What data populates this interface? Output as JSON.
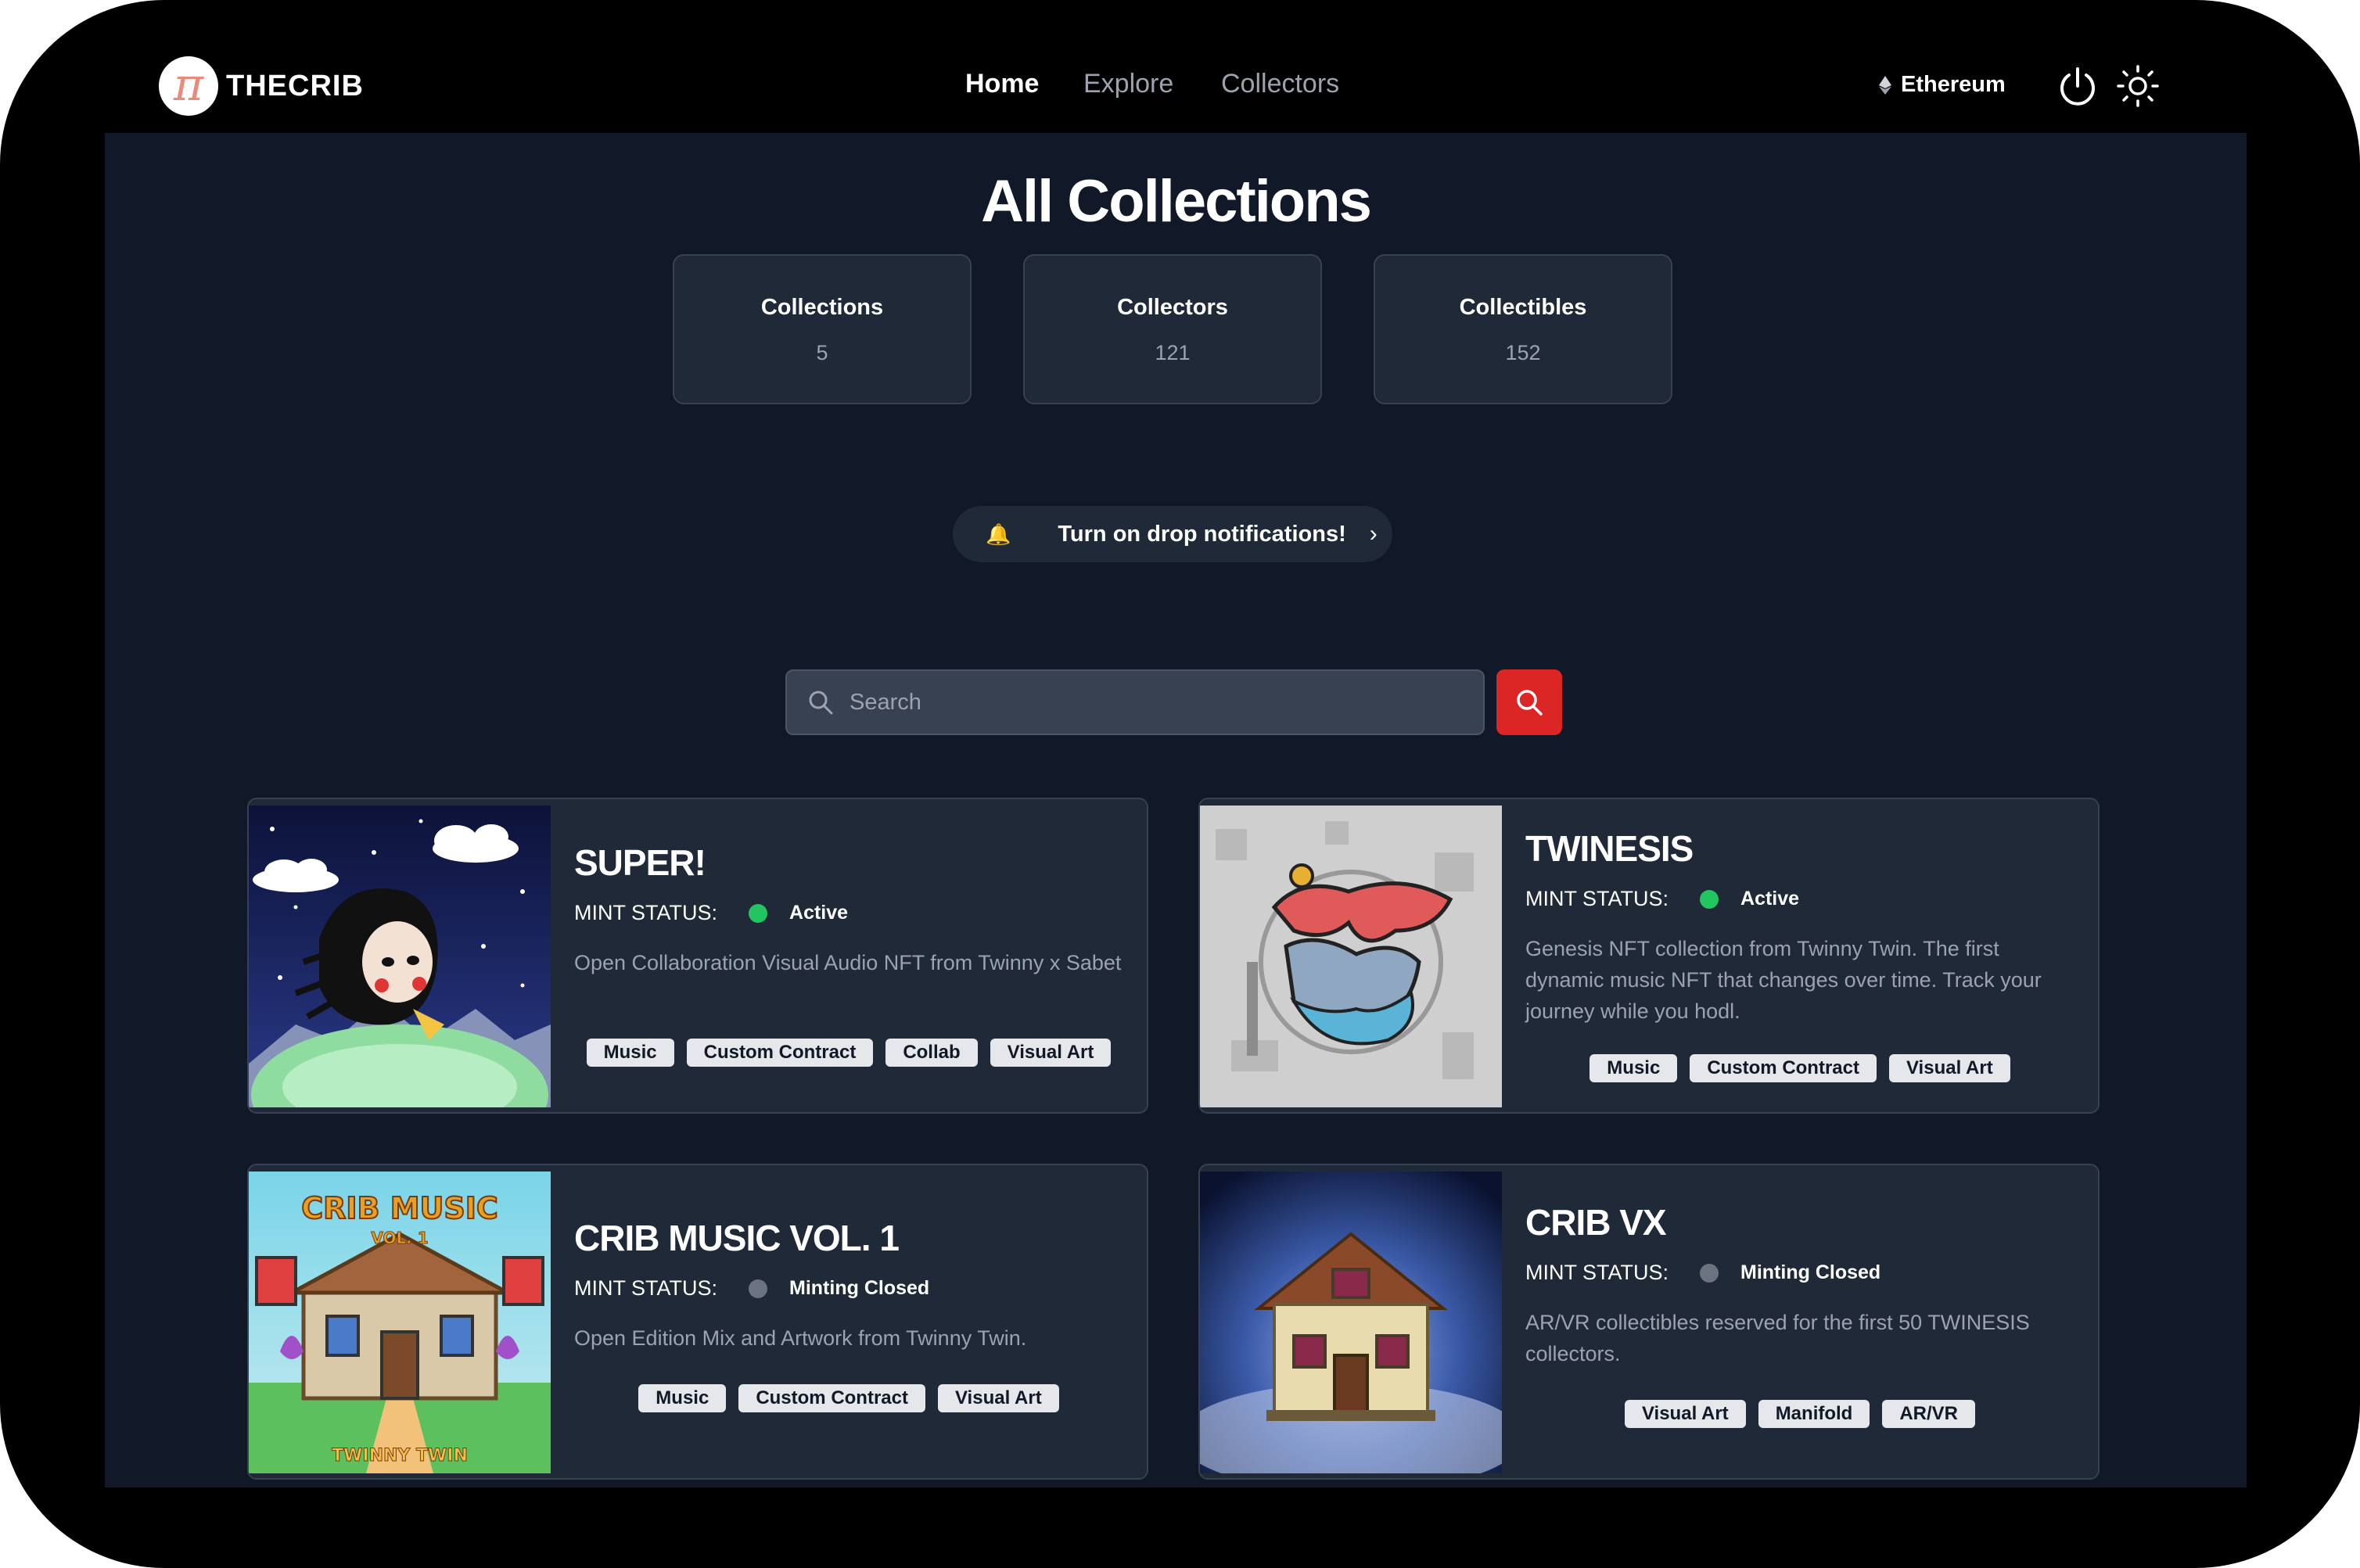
{
  "brand": {
    "name": "THECRIB",
    "logo_glyph": "π"
  },
  "nav": {
    "home": "Home",
    "explore": "Explore",
    "collectors": "Collectors"
  },
  "network": {
    "label": "Ethereum",
    "icon": "ethereum-icon"
  },
  "header_icons": [
    "power-icon",
    "sun-icon"
  ],
  "page": {
    "title": "All Collections"
  },
  "stats": [
    {
      "label": "Collections",
      "value": "5"
    },
    {
      "label": "Collectors",
      "value": "121"
    },
    {
      "label": "Collectibles",
      "value": "152"
    }
  ],
  "notify": {
    "label": "Turn on drop notifications!",
    "bell": "🔔",
    "chevron": "›"
  },
  "search": {
    "placeholder": "Search",
    "value": ""
  },
  "collections": [
    {
      "title": "SUPER!",
      "mint_label": "MINT STATUS:",
      "status": "Active",
      "status_color": "#22c55e",
      "description": "Open Collaboration Visual Audio NFT from Twinny x Sabet",
      "tags": [
        "Music",
        "Custom Contract",
        "Collab",
        "Visual Art"
      ]
    },
    {
      "title": "TWINESIS",
      "mint_label": "MINT STATUS:",
      "status": "Active",
      "status_color": "#22c55e",
      "description": "Genesis NFT collection from Twinny Twin. The first dynamic music NFT that changes over time. Track your journey while you hodl.",
      "tags": [
        "Music",
        "Custom Contract",
        "Visual Art"
      ]
    },
    {
      "title": "CRIB MUSIC VOL. 1",
      "mint_label": "MINT STATUS:",
      "status": "Minting Closed",
      "status_color": "#6b7280",
      "description": "Open Edition Mix and Artwork from Twinny Twin.",
      "tags": [
        "Music",
        "Custom Contract",
        "Visual Art"
      ],
      "art_text": {
        "top": "CRIB MUSIC",
        "sub": "VOL. 1",
        "bottom": "TWINNY TWIN"
      }
    },
    {
      "title": "CRIB VX",
      "mint_label": "MINT STATUS:",
      "status": "Minting Closed",
      "status_color": "#6b7280",
      "description": "AR/VR collectibles reserved for the first 50 TWINESIS collectors.",
      "tags": [
        "Visual Art",
        "Manifold",
        "AR/VR"
      ]
    }
  ],
  "colors": {
    "accent": "#dc2626",
    "panel": "#111827",
    "card": "#1f2937",
    "active": "#22c55e",
    "closed": "#6b7280"
  }
}
